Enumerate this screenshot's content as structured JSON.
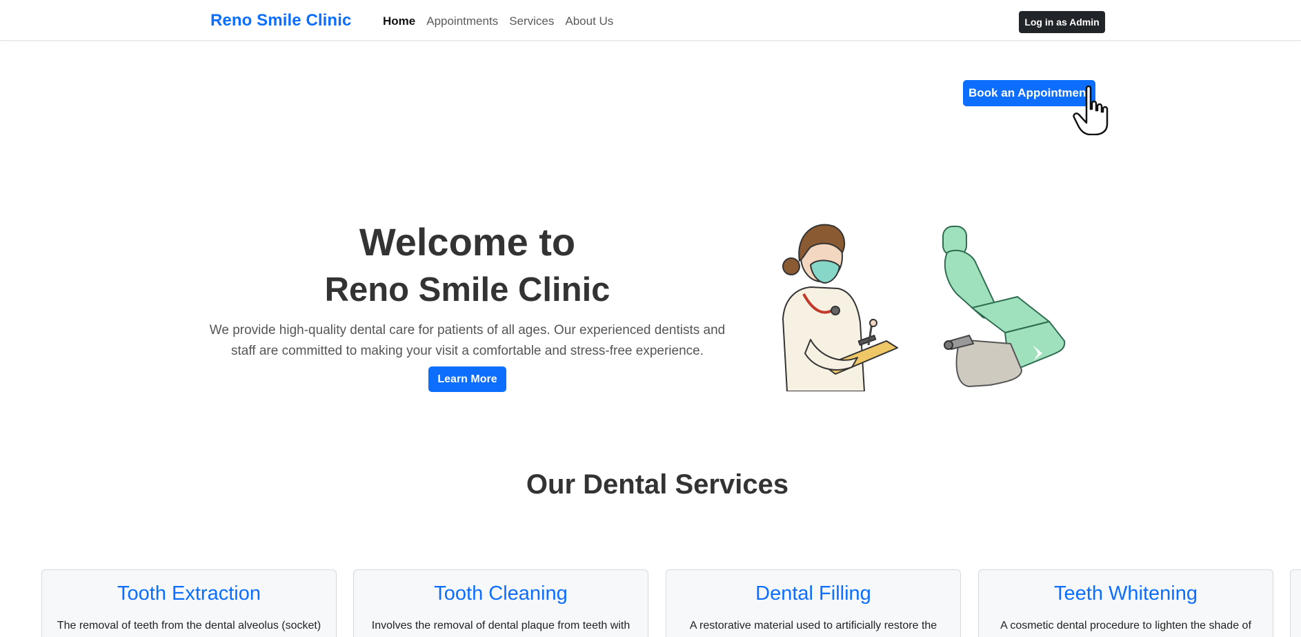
{
  "navbar": {
    "brand": "Reno Smile Clinic",
    "links": [
      "Home",
      "Appointments",
      "Services",
      "About Us"
    ],
    "admin_button": "Log in as Admin"
  },
  "book_button": "Book an Appointment",
  "hero": {
    "title_line1": "Welcome to",
    "title_line2": "Reno Smile Clinic",
    "description": "We provide high-quality dental care for patients of all ages. Our experienced dentists and staff are committed to making your visit a comfortable and stress-free experience.",
    "button": "Learn More"
  },
  "services": {
    "title": "Our Dental Services",
    "cards": [
      {
        "title": "Tooth Extraction",
        "text": "The removal of teeth from the dental alveolus (socket)"
      },
      {
        "title": "Tooth Cleaning",
        "text": "Involves the removal of dental plaque from teeth with"
      },
      {
        "title": "Dental Filling",
        "text": "A restorative material used to artificially restore the"
      },
      {
        "title": "Teeth Whitening",
        "text": "A cosmetic dental procedure to lighten the shade of"
      }
    ]
  },
  "colors": {
    "primary": "#0d6efd",
    "dark": "#212529",
    "chair": "#9fe0bd"
  },
  "icons": {
    "cursor": "hand-pointer-icon",
    "illustration": "dentist-and-dental-chair-illustration"
  }
}
